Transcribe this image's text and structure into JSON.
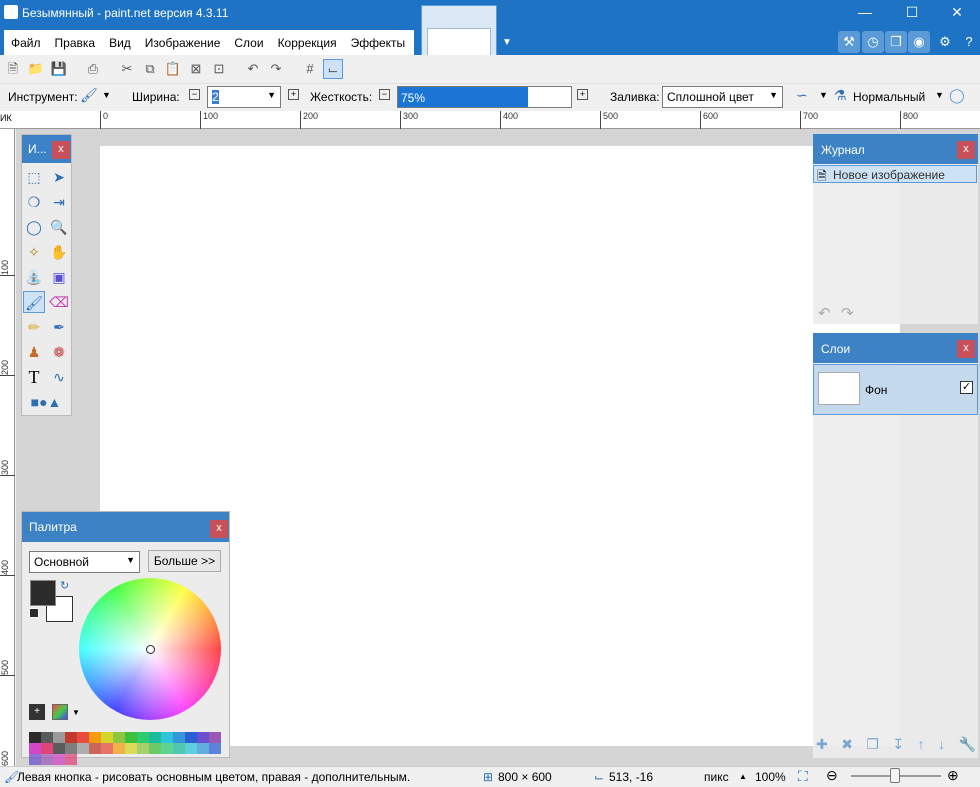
{
  "window": {
    "title": "Безымянный - paint.net версия 4.3.11"
  },
  "menu": [
    "Файл",
    "Правка",
    "Вид",
    "Изображение",
    "Слои",
    "Коррекция",
    "Эффекты"
  ],
  "toolbar": {
    "tool_label": "Инструмент:",
    "width_label": "Ширина:",
    "width_value": "2",
    "hardness_label": "Жесткость:",
    "hardness_value": "75%",
    "hardness_fraction": 0.75,
    "fill_label": "Заливка:",
    "fill_value": "Сплошной цвет",
    "blend_value": "Нормальный"
  },
  "rulers": {
    "corner": "ИК",
    "top_ticks": [
      "0",
      "100",
      "200",
      "300",
      "400",
      "500",
      "600",
      "700",
      "800"
    ],
    "left_ticks": [
      "100",
      "200",
      "300",
      "400",
      "500",
      "600"
    ]
  },
  "tools_panel": {
    "title": "И...",
    "close": "x"
  },
  "palette": {
    "title": "Палитра",
    "close": "x",
    "mode": "Основной",
    "more_button": "Больше >>",
    "swatches": [
      "#2b2b2b",
      "#5a5a5a",
      "#9a9a9a",
      "#c0392b",
      "#e74c3c",
      "#f39c12",
      "#d4d42a",
      "#8dc63f",
      "#3dbf3d",
      "#2ecc71",
      "#1abc9c",
      "#2ec4d9",
      "#3498db",
      "#2d5fd4",
      "#6b4fd1",
      "#9b59b6",
      "#d246c7",
      "#e0457a"
    ]
  },
  "history": {
    "title": "Журнал",
    "close": "x",
    "items": [
      "Новое изображение"
    ]
  },
  "layers": {
    "title": "Слои",
    "close": "x",
    "items": [
      {
        "name": "Фон",
        "visible": true
      }
    ]
  },
  "status": {
    "hint": "Левая кнопка - рисовать основным цветом, правая - дополнительным.",
    "size": "800 × 600",
    "cursor": "513, -16",
    "units": "пикс",
    "zoom": "100%"
  }
}
